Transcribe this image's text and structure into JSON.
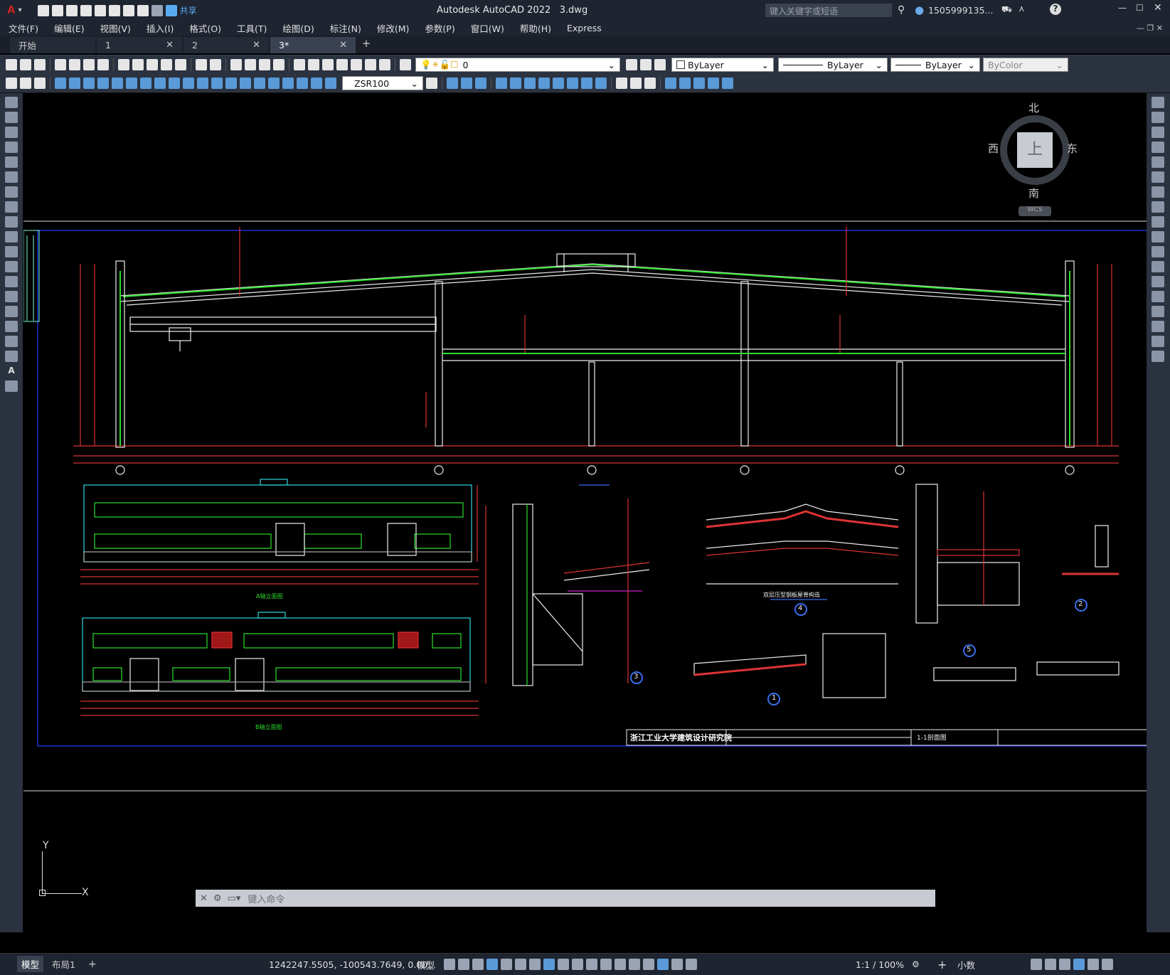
{
  "app": {
    "title": "Autodesk AutoCAD 2022",
    "filename": "3.dwg",
    "share_label": "共享",
    "search_placeholder": "键入关键字或短语",
    "user": "1505999135...",
    "accent_color": "#d9261c"
  },
  "menu": [
    "文件(F)",
    "编辑(E)",
    "视图(V)",
    "插入(I)",
    "格式(O)",
    "工具(T)",
    "绘图(D)",
    "标注(N)",
    "修改(M)",
    "参数(P)",
    "窗口(W)",
    "帮助(H)",
    "Express"
  ],
  "tabs": [
    {
      "label": "开始",
      "closable": false
    },
    {
      "label": "1",
      "closable": true
    },
    {
      "label": "2",
      "closable": true
    },
    {
      "label": "3*",
      "closable": true,
      "active": true
    }
  ],
  "toolbar": {
    "layer_value": "0",
    "color_value": "ByLayer",
    "linetype_value": "ByLayer",
    "lineweight_value": "ByLayer",
    "plotstyle_value": "ByColor",
    "dimstyle_value": "ZSR100"
  },
  "viewcube": {
    "north": "北",
    "south": "南",
    "east": "东",
    "west": "西",
    "top": "上",
    "wcs": "WCS"
  },
  "drawing": {
    "title_block": "浙江工业大学建筑设计研究院",
    "section_label": "1-1剖面图",
    "detail_labels": [
      "1",
      "2",
      "3",
      "4",
      "5"
    ],
    "elevation_a": "A轴立面图",
    "elevation_b": "B轴立面图",
    "roof_detail_caption": "双层压型钢板屋脊构造"
  },
  "ucs": {
    "x": "X",
    "y": "Y"
  },
  "command": {
    "placeholder": "键入命令"
  },
  "status": {
    "layout_tabs": [
      "模型",
      "布局1"
    ],
    "coords": "1242247.5505, -100543.7649, 0.00...",
    "model_label": "模型",
    "scale": "1:1 / 100%",
    "units": "小数"
  }
}
